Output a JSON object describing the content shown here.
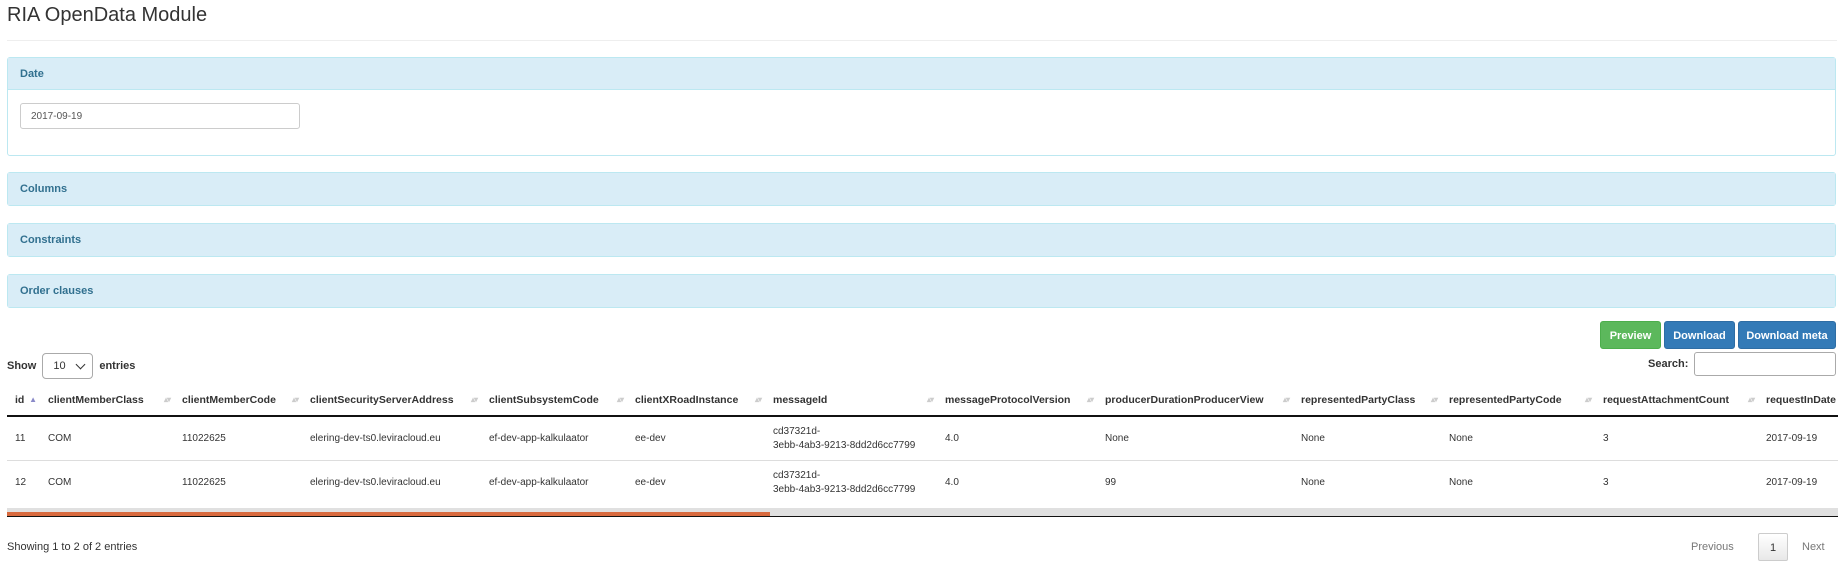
{
  "app": {
    "title": "RIA OpenData Module"
  },
  "panels": {
    "date": {
      "heading": "Date",
      "value": "2017-09-19"
    },
    "columns": {
      "heading": "Columns"
    },
    "constraints": {
      "heading": "Constraints"
    },
    "order": {
      "heading": "Order clauses"
    }
  },
  "buttons": {
    "preview": "Preview",
    "download": "Download",
    "download_meta": "Download meta"
  },
  "colors": {
    "success": "#5cb85c",
    "primary": "#337ab7",
    "panel_heading_bg": "#d9edf7",
    "panel_heading_text": "#31708f",
    "scroll_thumb": "#d86a3e"
  },
  "length": {
    "show": "Show",
    "value": "10",
    "entries": "entries"
  },
  "search": {
    "label": "Search:",
    "value": ""
  },
  "table": {
    "columns": [
      "id",
      "clientMemberClass",
      "clientMemberCode",
      "clientSecurityServerAddress",
      "clientSubsystemCode",
      "clientXRoadInstance",
      "messageId",
      "messageProtocolVersion",
      "producerDurationProducerView",
      "representedPartyClass",
      "representedPartyCode",
      "requestAttachmentCount",
      "requestInDate"
    ],
    "sorted_column": "id",
    "rows": [
      [
        "11",
        "COM",
        "11022625",
        "elering-dev-ts0.leviracloud.eu",
        "ef-dev-app-kalkulaator",
        "ee-dev",
        "cd37321d-3ebb-4ab3-9213-8dd2d6cc7799",
        "4.0",
        "None",
        "None",
        "None",
        "3",
        "2017-09-19"
      ],
      [
        "12",
        "COM",
        "11022625",
        "elering-dev-ts0.leviracloud.eu",
        "ef-dev-app-kalkulaator",
        "ee-dev",
        "cd37321d-3ebb-4ab3-9213-8dd2d6cc7799",
        "4.0",
        "99",
        "None",
        "None",
        "3",
        "2017-09-19"
      ]
    ]
  },
  "info": "Showing 1 to 2 of 2 entries",
  "pagination": {
    "previous": "Previous",
    "current": "1",
    "next": "Next"
  }
}
